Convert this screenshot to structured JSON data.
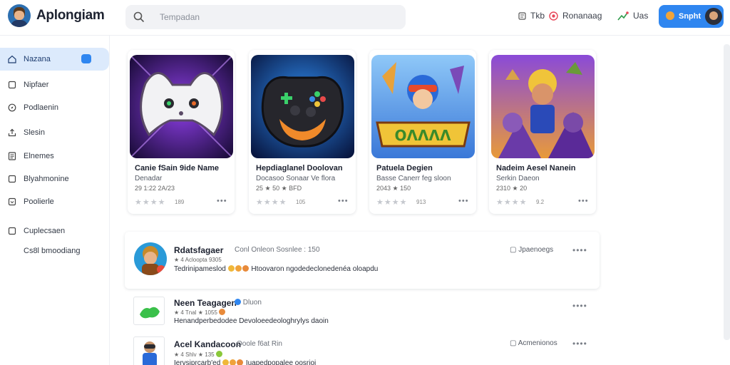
{
  "app": {
    "title": "Aplongiam"
  },
  "search": {
    "placeholder": "Tempadan"
  },
  "topnav": {
    "items": [
      {
        "label": "Tkb",
        "icon": "document-icon"
      },
      {
        "label": "Ronanaag",
        "icon": "target-icon"
      },
      {
        "label": "Uas",
        "icon": "trend-icon"
      }
    ],
    "cta": {
      "label": "Snpht"
    }
  },
  "sidebar": {
    "items": [
      {
        "label": "Nazana",
        "icon": "home-icon"
      },
      {
        "label": "Nipfaer",
        "icon": "square-icon"
      },
      {
        "label": "Podlaenin",
        "icon": "compass-icon"
      },
      {
        "label": "Slesin",
        "icon": "upload-icon"
      },
      {
        "label": "Elnemes",
        "icon": "list-icon"
      },
      {
        "label": "Blyahmonine",
        "icon": "square-icon"
      },
      {
        "label": "Poolierle",
        "icon": "box-icon"
      },
      {
        "label": "Cuplecsaen",
        "icon": "square-icon"
      },
      {
        "label": "Cs8l bmoodiang",
        "icon": ""
      }
    ]
  },
  "cards": [
    {
      "title": "Canie fSain 9ide Name",
      "subtitle": "Denadar",
      "meta": "29 1:22  2A/23",
      "rating_count": "189",
      "stars": 2,
      "colors": {
        "bg1": "#7a2fd0",
        "bg2": "#1a0c3a",
        "accent": "#c58cff"
      }
    },
    {
      "title": "Hepdiaglanel Doolovan",
      "subtitle": "Docasoo Sonaar Ve flora",
      "meta": "25  ★ 50 ★  BFD",
      "rating_count": "105",
      "stars": 2,
      "colors": {
        "bg1": "#1e6ad8",
        "bg2": "#0a1a44",
        "accent": "#f08a2a"
      }
    },
    {
      "title": "Patuela Degien",
      "subtitle": "Basse Canerr feg sloon",
      "meta": "2043  ★ 150",
      "rating_count": "913",
      "stars": 3,
      "colors": {
        "bg1": "#5ba8f0",
        "bg2": "#f0c438",
        "accent": "#e85a2a"
      }
    },
    {
      "title": "Nadeim Aesel Nanein",
      "subtitle": "Serkin Daeon",
      "meta": "2310  ★ 20",
      "rating_count": "9.2",
      "stars": 2,
      "colors": {
        "bg1": "#9a4ad8",
        "bg2": "#f0a23a",
        "accent": "#f0c43a"
      }
    }
  ],
  "posts": [
    {
      "name": "Rdatsfagaer",
      "handle": "Conl Onleon Sosnlee : 150",
      "meta": "★ 4 Acloopta  9305",
      "text": "Tedrinipameslod",
      "text2": "Htoovaron ngodedeclonedenéa oloapdu",
      "right": "Jpaenoegs",
      "right_icon": "chat-icon"
    },
    {
      "name": "Neen Teagagen",
      "handle": "Dluon",
      "meta": "★ 4 Tnal ★ 1055",
      "text": "Henandperbedodee Devoloeedeologhrylys daoin",
      "text2": "",
      "right": "",
      "right_icon": ""
    },
    {
      "name": "Acel Kandacoon",
      "handle": "Ooole f6at Rin",
      "meta": "★ 4 Shlv ★ 135",
      "text": "Iervsiprcarb'ed",
      "text2": "Iuapedpopalee oosrioi",
      "right": "Acmenionos",
      "right_icon": "chat-icon"
    }
  ],
  "colors": {
    "accent": "#2f86f0",
    "sidebar_active": "#dceafc"
  }
}
